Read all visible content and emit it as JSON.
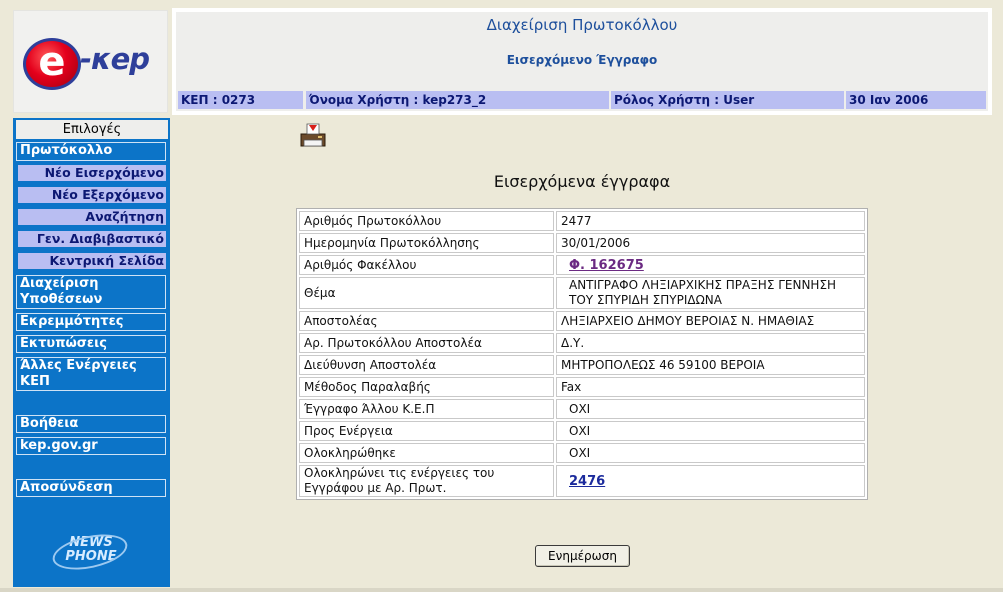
{
  "logo": {
    "e": "e",
    "brand": "-κep"
  },
  "header": {
    "title": "Διαχείριση Πρωτοκόλλου",
    "subtitle": "Εισερχόμενο Έγγραφο",
    "kep": "ΚΕΠ : 0273",
    "username": "Όνομα Χρήστη : kep273_2",
    "role": "Ρόλος Χρήστη : User",
    "date": "30 Ιαν 2006"
  },
  "sidebar": {
    "heading": "Επιλογές",
    "protocol": "Πρωτόκολλο",
    "sub": [
      "Νέο Εισερχόμενο",
      "Νέο Εξερχόμενο",
      "Αναζήτηση",
      "Γεν. Διαβιβαστικό",
      "Κεντρική Σελίδα"
    ],
    "cases_line1": "Διαχείριση",
    "cases_line2": "Υποθέσεων",
    "pending": "Εκρεμμότητες",
    "prints": "Εκτυπώσεις",
    "other_line1": "Άλλες Ενέργειες",
    "other_line2": "ΚΕΠ",
    "help": "Βοήθεια",
    "site": "kep.gov.gr",
    "logout": "Αποσύνδεση",
    "footer_logo_line1": "NEWS",
    "footer_logo_line2": "PHONE"
  },
  "main": {
    "title": "Εισερχόμενα έγγραφα",
    "rows": [
      {
        "label": "Αριθμός Πρωτοκόλλου",
        "value": "2477"
      },
      {
        "label": "Ημερομηνία Πρωτοκόλλησης",
        "value": "30/01/2006"
      },
      {
        "label": "Αριθμός Φακέλλου",
        "value": "Φ. 162675"
      },
      {
        "label": "Θέμα",
        "value": "ΑΝΤΙΓΡΑΦΟ ΛΗΞΙΑΡΧΙΚΗΣ ΠΡΑΞΗΣ ΓΕΝΝΗΣΗ ΤΟΥ ΣΠΥΡΙΔΗ ΣΠΥΡΙΔΩΝΑ"
      },
      {
        "label": "Αποστολέας",
        "value": "ΛΗΞΙΑΡΧΕΙΟ ΔΗΜΟΥ ΒΕΡΟΙΑΣ Ν. ΗΜΑΘΙΑΣ"
      },
      {
        "label": "Αρ. Πρωτοκόλλου Αποστολέα",
        "value": "Δ.Υ."
      },
      {
        "label": "Διεύθυνση Αποστολέα",
        "value": "ΜΗΤΡΟΠΟΛΕΩΣ 46 59100 ΒΕΡΟΙΑ"
      },
      {
        "label": "Μέθοδος Παραλαβής",
        "value": "Fax"
      },
      {
        "label": "Έγγραφο Άλλου Κ.Ε.Π",
        "value": "ΟΧΙ"
      },
      {
        "label": "Προς Ενέργεια",
        "value": "ΟΧΙ"
      },
      {
        "label": "Ολοκληρώθηκε",
        "value": "ΟΧΙ"
      },
      {
        "label": "Ολοκληρώνει τις ενέργειες του Εγγράφου με Αρ. Πρωτ.",
        "value": "2476"
      }
    ],
    "update_button": "Ενημέρωση"
  },
  "colors": {
    "sidebar_bg": "#0c74c8",
    "info_bar": "#b9bef2",
    "title_blue": "#1d4f9c"
  },
  "icons": {
    "print": "printer-icon"
  }
}
